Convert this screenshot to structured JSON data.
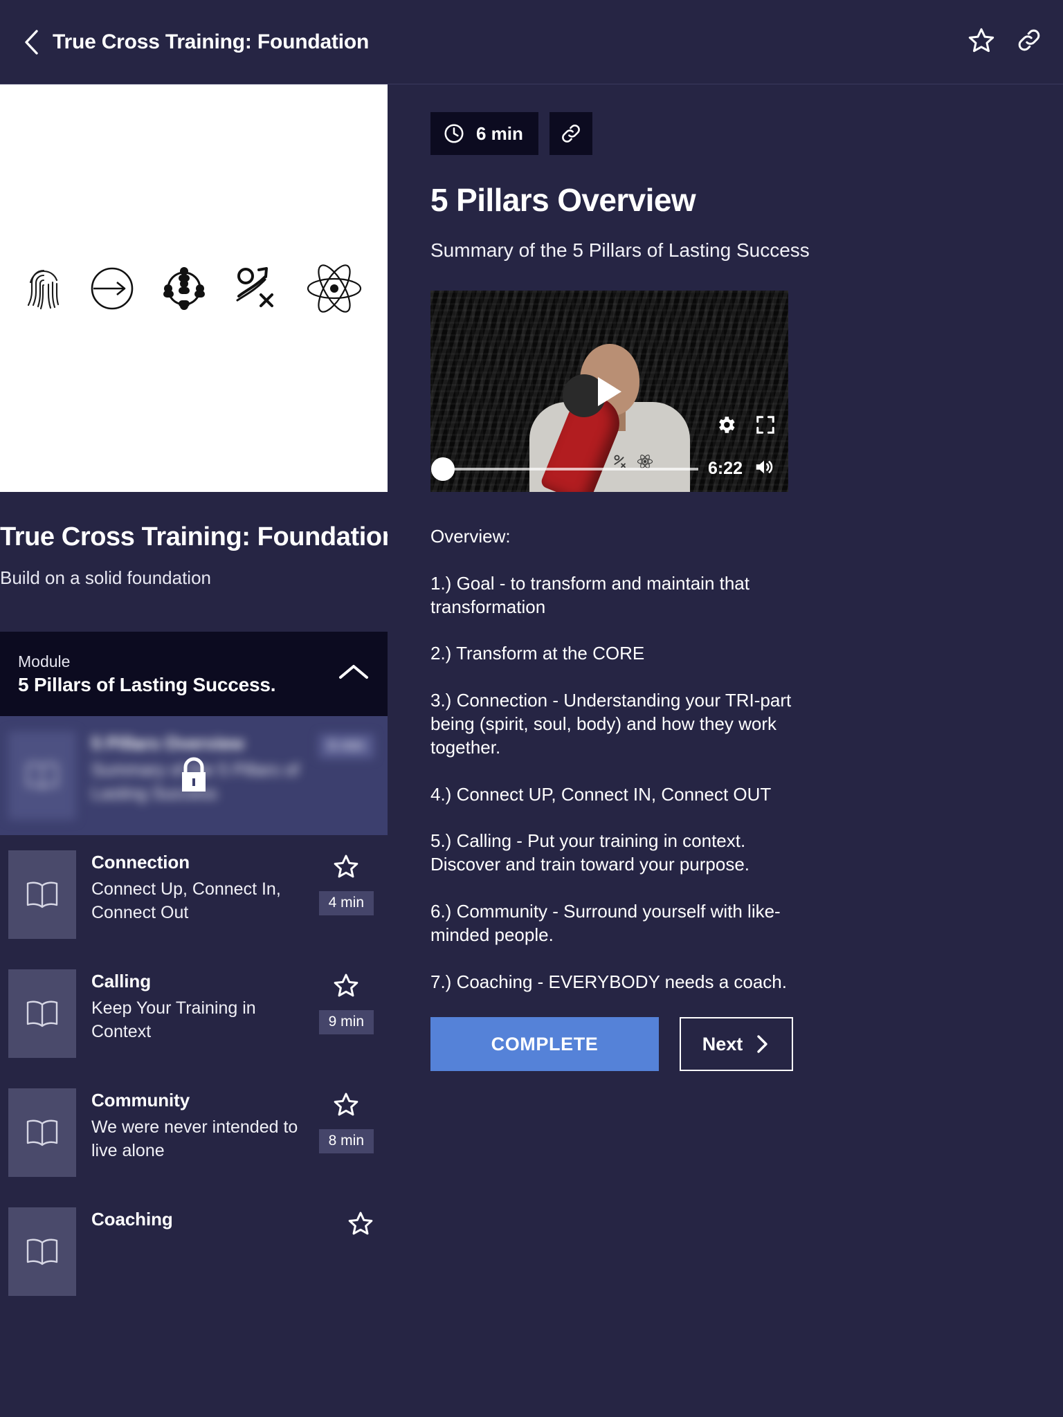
{
  "topbar": {
    "title": "True Cross Training: Foundation",
    "back_icon": "chevron-left-icon",
    "star_icon": "star-outline-icon",
    "link_icon": "link-icon"
  },
  "course": {
    "title": "True Cross Training: Foundation",
    "subtitle": "Build on a solid foundation",
    "hero_icons": [
      "fingerprint-icon",
      "arrow-right-circle-icon",
      "network-people-icon",
      "growth-arrow-icon",
      "atom-icon"
    ]
  },
  "module": {
    "kicker": "Module",
    "name": "5 Pillars of Lasting Success.",
    "collapse_icon": "chevron-up-icon"
  },
  "lessons": [
    {
      "name": "5 Pillars Overview",
      "desc": "Summary of the 5 Pillars of Lasting Success",
      "time": "6 min",
      "locked": true,
      "active": true,
      "thumb_icon": "book-icon",
      "lock_icon": "lock-icon"
    },
    {
      "name": "Connection",
      "desc": "Connect Up, Connect In, Connect Out",
      "time": "4 min",
      "locked": false,
      "active": false,
      "thumb_icon": "book-icon",
      "star_icon": "star-outline-icon"
    },
    {
      "name": "Calling",
      "desc": "Keep Your Training in Context",
      "time": "9 min",
      "locked": false,
      "active": false,
      "thumb_icon": "book-icon",
      "star_icon": "star-outline-icon"
    },
    {
      "name": "Community",
      "desc": "We were never intended to live alone",
      "time": "8 min",
      "locked": false,
      "active": false,
      "thumb_icon": "book-icon",
      "star_icon": "star-outline-icon"
    },
    {
      "name": "Coaching",
      "desc": "",
      "time": "",
      "locked": false,
      "active": false,
      "thumb_icon": "book-icon",
      "star_icon": "star-outline-icon"
    }
  ],
  "detail": {
    "duration": "6 min",
    "clock_icon": "clock-icon",
    "link_icon": "link-icon",
    "title": "5 Pillars Overview",
    "subtitle": "Summary of the 5 Pillars of Lasting Success"
  },
  "video": {
    "play_icon": "play-icon",
    "settings_icon": "gear-icon",
    "fullscreen_icon": "fullscreen-icon",
    "volume_icon": "volume-icon",
    "time_remaining": "6:22",
    "progress_percent": 0
  },
  "overview": {
    "heading": "Overview:",
    "items": [
      "1.) Goal - to transform and maintain that transformation",
      "2.) Transform at the CORE",
      "3.) Connection - Understanding your TRI-part being (spirit, soul, body) and how they work together.",
      "4.) Connect UP, Connect IN, Connect OUT",
      "5.) Calling - Put your training in context. Discover and train toward your purpose.",
      "6.) Community - Surround yourself with like-minded people.",
      "7.) Coaching - EVERYBODY needs a coach."
    ]
  },
  "actions": {
    "complete_label": "COMPLETE",
    "next_label": "Next",
    "next_icon": "chevron-right-icon"
  },
  "colors": {
    "page_bg": "#262544",
    "panel_dark": "#0c0b20",
    "accent": "#5582d8",
    "active_row": "#3c3f6e",
    "badge": "#45456a"
  }
}
